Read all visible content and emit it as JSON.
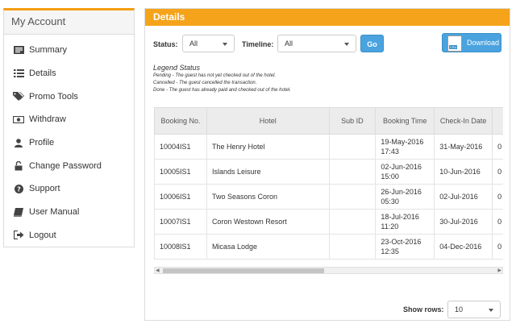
{
  "sidebar": {
    "title": "My Account",
    "items": [
      {
        "label": "Summary",
        "icon": "summary-icon"
      },
      {
        "label": "Details",
        "icon": "list-icon"
      },
      {
        "label": "Promo Tools",
        "icon": "tags-icon"
      },
      {
        "label": "Withdraw",
        "icon": "money-icon"
      },
      {
        "label": "Profile",
        "icon": "user-icon"
      },
      {
        "label": "Change Password",
        "icon": "unlock-icon"
      },
      {
        "label": "Support",
        "icon": "question-icon"
      },
      {
        "label": "User Manual",
        "icon": "book-icon"
      },
      {
        "label": "Logout",
        "icon": "signout-icon"
      }
    ]
  },
  "panel": {
    "title": "Details",
    "status_label": "Status:",
    "status_value": "All",
    "timeline_label": "Timeline:",
    "timeline_value": "All",
    "go_label": "Go",
    "download_label": "Download",
    "csv_badge": "CSV"
  },
  "legend": {
    "title": "Legend Status",
    "lines": [
      "Pending - The guest has not yet checked out of the hotel.",
      "Cancelled - The guest cancelled the transaction.",
      "Done - The guest has already paid and checked out of the hotel."
    ]
  },
  "table": {
    "headers": [
      "Booking No.",
      "Hotel",
      "Sub ID",
      "Booking Time",
      "Check-In Date"
    ],
    "rows": [
      {
        "no": "10004IS1",
        "hotel": "The Henry Hotel",
        "sub": "",
        "time": "19-May-2016 17:43",
        "checkin": "31-May-2016",
        "extra": "0"
      },
      {
        "no": "10005IS1",
        "hotel": "Islands Leisure",
        "sub": "",
        "time": "02-Jun-2016 15:00",
        "checkin": "10-Jun-2016",
        "extra": "0"
      },
      {
        "no": "10006IS1",
        "hotel": "Two Seasons Coron",
        "sub": "",
        "time": "26-Jun-2016 05:30",
        "checkin": "02-Jul-2016",
        "extra": "0"
      },
      {
        "no": "10007IS1",
        "hotel": "Coron Westown Resort",
        "sub": "",
        "time": "18-Jul-2016 11:20",
        "checkin": "30-Jul-2016",
        "extra": "0"
      },
      {
        "no": "10008IS1",
        "hotel": "Micasa Lodge",
        "sub": "",
        "time": "23-Oct-2016 12:35",
        "checkin": "04-Dec-2016",
        "extra": "0"
      }
    ]
  },
  "footer": {
    "show_rows_label": "Show rows:",
    "show_rows_value": "10"
  },
  "colors": {
    "accent": "#f5a31a",
    "button": "#4aa3df"
  }
}
